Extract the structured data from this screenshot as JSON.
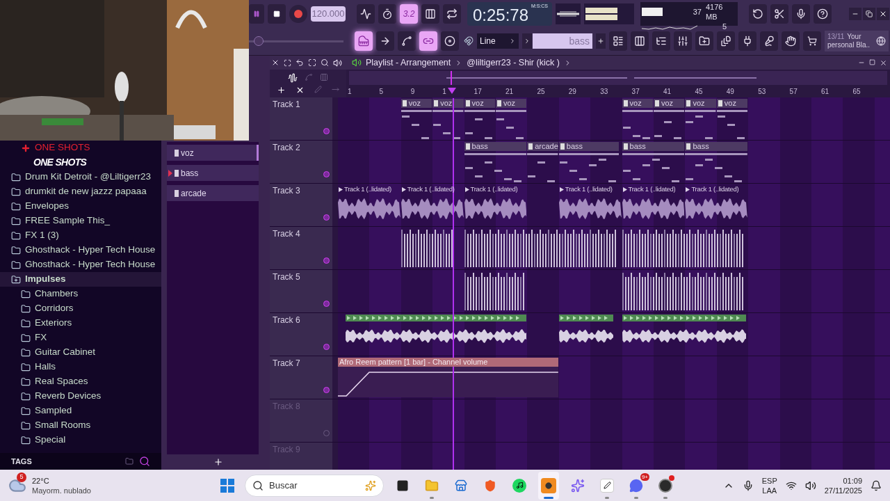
{
  "toolbar": {
    "master_pitch": {
      "level": 0.06
    },
    "tempo": "120.000",
    "time": "0:25:78",
    "time_format": "M:S:CS",
    "cpu": "37",
    "memory": "4176 MB",
    "polyphony": "5",
    "row1": [
      {
        "kind": "metronome",
        "on": false
      },
      {
        "kind": "wait",
        "on": false
      },
      {
        "kind": "countdown",
        "label": "3.2",
        "on": true
      },
      {
        "kind": "step",
        "on": false
      },
      {
        "kind": "loop",
        "on": false
      }
    ],
    "row2": [
      {
        "kind": "piano",
        "on": true
      },
      {
        "kind": "arrow",
        "on": false
      },
      {
        "kind": "slide",
        "on": false
      },
      {
        "kind": "link",
        "on": true
      },
      {
        "kind": "knob",
        "on": false
      }
    ],
    "snap": "Line",
    "pattern": "bass",
    "news_date": "13/11",
    "news_text": "Your personal Bla.."
  },
  "browser": {
    "items": [
      {
        "label": "ONE SHOTS",
        "kind": "current"
      },
      {
        "label": "ONE SHOTS",
        "kind": "banner"
      },
      {
        "label": "Drum Kit Detroit - @Liltigerr23",
        "kind": "folder",
        "selected": false,
        "expanded": false
      },
      {
        "label": "drumkit de new jazzz papaaa",
        "kind": "folder",
        "selected": false,
        "expanded": false
      },
      {
        "label": "Envelopes",
        "kind": "folder",
        "selected": false,
        "expanded": false
      },
      {
        "label": "FREE Sample This_",
        "kind": "folder",
        "selected": false,
        "expanded": false
      },
      {
        "label": "FX 1 (3)",
        "kind": "folder",
        "selected": false,
        "expanded": false
      },
      {
        "label": "Ghosthack - Hyper Tech House",
        "kind": "folder",
        "selected": false,
        "expanded": false
      },
      {
        "label": "Ghosthack - Hyper Tech House",
        "kind": "folder",
        "selected": false,
        "expanded": false
      },
      {
        "label": "Impulses",
        "kind": "folder",
        "selected": true,
        "expanded": true,
        "children": [
          {
            "label": "Chambers",
            "kind": "folder",
            "selected": false
          },
          {
            "label": "Corridors",
            "kind": "folder",
            "selected": false
          },
          {
            "label": "Exteriors",
            "kind": "folder",
            "selected": false
          },
          {
            "label": "FX",
            "kind": "folder",
            "selected": false
          },
          {
            "label": "Guitar Cabinet",
            "kind": "folder",
            "selected": false
          },
          {
            "label": "Halls",
            "kind": "folder",
            "selected": false
          },
          {
            "label": "Real Spaces",
            "kind": "folder",
            "selected": false
          },
          {
            "label": "Reverb Devices",
            "kind": "folder",
            "selected": false
          },
          {
            "label": "Sampled",
            "kind": "folder",
            "selected": false
          },
          {
            "label": "Small Rooms",
            "kind": "folder",
            "selected": false
          },
          {
            "label": "Special",
            "kind": "folder",
            "selected": false
          }
        ]
      }
    ],
    "tags": "TAGS"
  },
  "patterns": [
    {
      "name": "voz",
      "selected": true,
      "current": false
    },
    {
      "name": "bass",
      "selected": false,
      "current": true
    },
    {
      "name": "arcade",
      "selected": false,
      "current": false
    }
  ],
  "playlist": {
    "title": "Playlist - Arrangement",
    "song": "@liltigerr23 - Shir (kick )",
    "ruler": [
      "1",
      "5",
      "9",
      "1",
      "17",
      "21",
      "25",
      "29",
      "33",
      "37",
      "41",
      "45",
      "49",
      "53",
      "57",
      "61",
      "65"
    ],
    "tracks": [
      {
        "name": "Track 1",
        "empty": false,
        "clips": [
          {
            "kind": "pattern",
            "label": "voz"
          },
          {
            "kind": "pattern",
            "label": "voz"
          },
          {
            "kind": "pattern",
            "label": "voz"
          },
          {
            "kind": "pattern",
            "label": "voz"
          },
          {
            "kind": "pattern",
            "label": "voz"
          },
          {
            "kind": "pattern",
            "label": "voz"
          },
          {
            "kind": "pattern",
            "label": "voz"
          },
          {
            "kind": "pattern",
            "label": "voz"
          }
        ]
      },
      {
        "name": "Track 2",
        "empty": false,
        "clips": [
          {
            "kind": "pattern",
            "label": "bass"
          },
          {
            "kind": "pattern",
            "label": "arcade"
          },
          {
            "kind": "pattern",
            "label": "bass"
          },
          {
            "kind": "pattern",
            "label": "bass"
          },
          {
            "kind": "pattern",
            "label": "bass"
          }
        ]
      },
      {
        "name": "Track 3",
        "empty": false,
        "clips": [
          {
            "kind": "audio",
            "label": "Track 1 (..lidated)"
          },
          {
            "kind": "audio",
            "label": "Track 1 (..lidated)"
          },
          {
            "kind": "audio",
            "label": "Track 1 (..lidated)"
          },
          {
            "kind": "audio",
            "label": "Track 1 (..lidated)"
          },
          {
            "kind": "audio",
            "label": "Track 1 (..lidated)"
          },
          {
            "kind": "audio",
            "label": "Track 1 (..lidated)"
          }
        ]
      },
      {
        "name": "Track 4",
        "empty": false,
        "clips": [
          {
            "kind": "slices"
          },
          {
            "kind": "slices"
          },
          {
            "kind": "slices"
          }
        ]
      },
      {
        "name": "Track 5",
        "empty": false,
        "clips": [
          {
            "kind": "slices"
          },
          {
            "kind": "slices"
          }
        ]
      },
      {
        "name": "Track 6",
        "empty": false,
        "clips": [
          {
            "kind": "loop"
          },
          {
            "kind": "loop"
          },
          {
            "kind": "loop"
          }
        ]
      },
      {
        "name": "Track 7",
        "empty": false,
        "clips": [
          {
            "kind": "automation",
            "label": "Afro Reem pattern [1 bar] - Channel volume"
          }
        ]
      },
      {
        "name": "Track 8",
        "empty": true
      },
      {
        "name": "Track 9",
        "empty": true
      }
    ]
  },
  "taskbar": {
    "weather_badge": "5",
    "temperature": "22°C",
    "weather_text": "Mayorm. nublado",
    "search": "Buscar",
    "apps": [
      {
        "kind": "taskview",
        "running": false
      },
      {
        "kind": "files",
        "running": true
      },
      {
        "kind": "store",
        "running": false
      },
      {
        "kind": "shield",
        "running": false
      },
      {
        "kind": "waves",
        "running": false
      },
      {
        "kind": "fruit",
        "running": true
      },
      {
        "kind": "swirl",
        "running": false
      },
      {
        "kind": "pen",
        "running": true
      },
      {
        "kind": "chat",
        "running": true,
        "badge": "9+"
      },
      {
        "kind": "record",
        "running": true
      }
    ],
    "language": "ESP",
    "region": "LAA",
    "time": "01:09",
    "date": "27/11/2025"
  }
}
